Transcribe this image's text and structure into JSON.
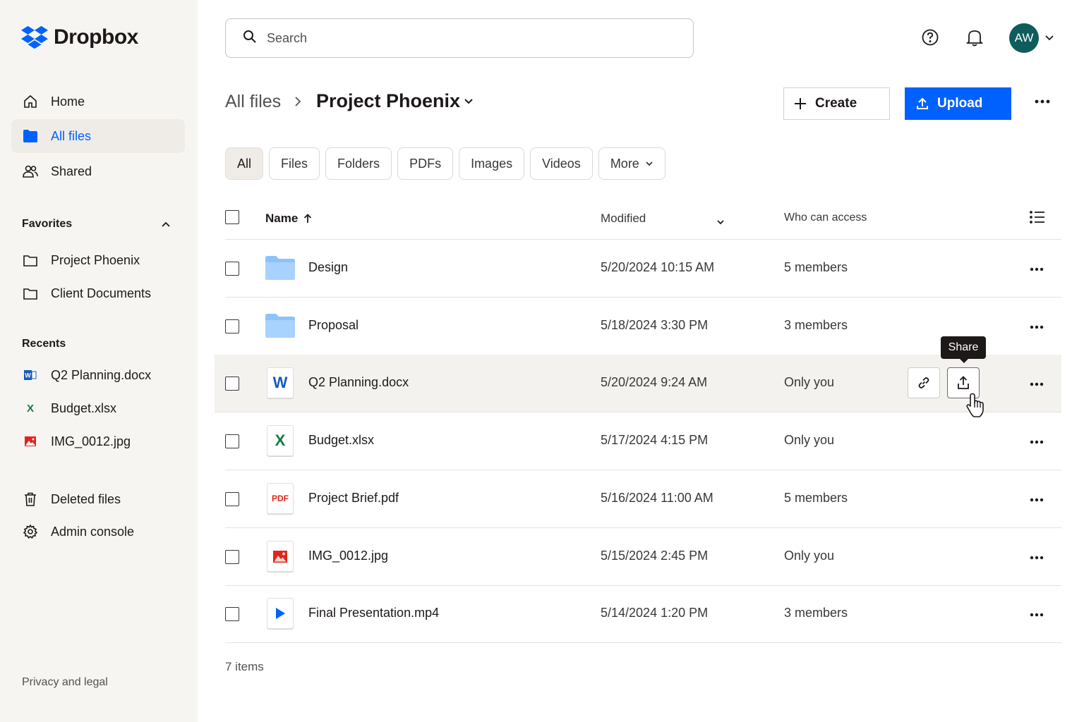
{
  "brand": {
    "name": "Dropbox",
    "color": "#0061fe"
  },
  "sidebar": {
    "nav": [
      {
        "label": "Home",
        "icon": "home-icon"
      },
      {
        "label": "All files",
        "icon": "folder-icon",
        "active": true
      },
      {
        "label": "Shared",
        "icon": "people-icon"
      }
    ],
    "favorites_label": "Favorites",
    "favorites": [
      {
        "label": "Project Phoenix",
        "icon": "folder-outline-icon"
      },
      {
        "label": "Client Documents",
        "icon": "folder-outline-icon"
      }
    ],
    "recents_label": "Recents",
    "recents": [
      {
        "label": "Q2 Planning.docx",
        "icon": "word-icon"
      },
      {
        "label": "Budget.xlsx",
        "icon": "excel-icon"
      },
      {
        "label": "IMG_0012.jpg",
        "icon": "image-icon"
      }
    ],
    "bottom": [
      {
        "label": "Deleted files",
        "icon": "trash-icon"
      },
      {
        "label": "Admin console",
        "icon": "gear-icon"
      }
    ],
    "footer": "Privacy and legal"
  },
  "header": {
    "search_placeholder": "Search",
    "avatar_initials": "AW"
  },
  "breadcrumb": {
    "root": "All files",
    "current": "Project Phoenix"
  },
  "actions": {
    "create": "Create",
    "upload": "Upload"
  },
  "filters": [
    "All",
    "Files",
    "Folders",
    "PDFs",
    "Images",
    "Videos",
    "More"
  ],
  "table": {
    "columns": {
      "name": "Name",
      "modified": "Modified",
      "access": "Who can access"
    },
    "rows": [
      {
        "name": "Design",
        "type": "folder",
        "modified": "5/20/2024 10:15 AM",
        "access": "5 members"
      },
      {
        "name": "Proposal",
        "type": "folder",
        "modified": "5/18/2024 3:30 PM",
        "access": "3 members"
      },
      {
        "name": "Q2 Planning.docx",
        "type": "word",
        "modified": "5/20/2024 9:24 AM",
        "access": "Only you"
      },
      {
        "name": "Budget.xlsx",
        "type": "excel",
        "modified": "5/17/2024 4:15 PM",
        "access": "Only you"
      },
      {
        "name": "Project Brief.pdf",
        "type": "pdf",
        "modified": "5/16/2024 11:00 AM",
        "access": "5 members"
      },
      {
        "name": "IMG_0012.jpg",
        "type": "image",
        "modified": "5/15/2024 2:45 PM",
        "access": "Only you"
      },
      {
        "name": "Final Presentation.mp4",
        "type": "video",
        "modified": "5/14/2024 1:20 PM",
        "access": "3 members"
      }
    ],
    "tooltip": "Share",
    "count": "7 items"
  },
  "glyphs": {
    "word": "W",
    "excel": "X",
    "pdf": "PDF"
  }
}
